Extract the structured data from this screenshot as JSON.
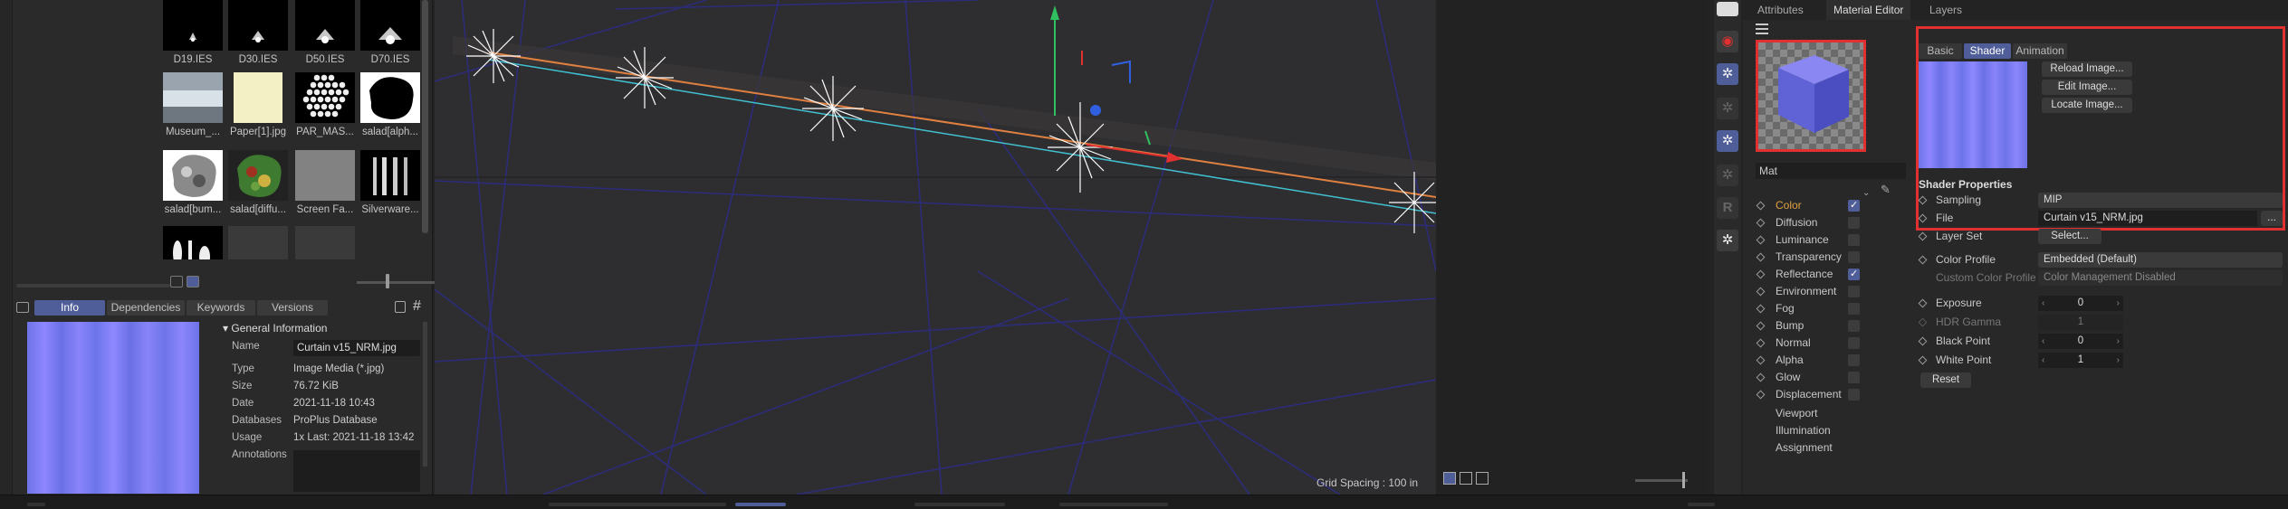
{
  "asset_browser": {
    "thumbnails": [
      {
        "label": "D19.IES",
        "kind": "ies"
      },
      {
        "label": "D30.IES",
        "kind": "ies"
      },
      {
        "label": "D50.IES",
        "kind": "ies"
      },
      {
        "label": "D70.IES",
        "kind": "ies"
      },
      {
        "label": "Museum_...",
        "kind": "museum"
      },
      {
        "label": "Paper[1].jpg",
        "kind": "paper"
      },
      {
        "label": "PAR_MAS...",
        "kind": "par"
      },
      {
        "label": "salad[alph...",
        "kind": "salad-alpha"
      },
      {
        "label": "salad[bum...",
        "kind": "salad-bump"
      },
      {
        "label": "salad[diffu...",
        "kind": "salad-diffuse"
      },
      {
        "label": "Screen Fa...",
        "kind": "screen"
      },
      {
        "label": "Silverware...",
        "kind": "silverware"
      },
      {
        "label": "",
        "kind": "cutlery"
      },
      {
        "label": "",
        "kind": "blank"
      },
      {
        "label": "",
        "kind": "blank"
      }
    ],
    "info_tabs": [
      "Info",
      "Dependencies",
      "Keywords",
      "Versions"
    ],
    "active_info_tab": "Info",
    "info": {
      "section_title": "▾ General Information",
      "rows": [
        {
          "key": "Name",
          "value": "Curtain v15_NRM.jpg"
        },
        {
          "key": "Type",
          "value": "Image Media (*.jpg)"
        },
        {
          "key": "Size",
          "value": "76.72 KiB"
        },
        {
          "key": "Date",
          "value": "2021-11-18 10:43"
        },
        {
          "key": "Databases",
          "value": "ProPlus Database"
        },
        {
          "key": "Usage",
          "value": "1x Last: 2021-11-18 13:42"
        },
        {
          "key": "Annotations",
          "value": ""
        }
      ]
    }
  },
  "viewport": {
    "grid_spacing": "Grid Spacing : 100 in"
  },
  "material_editor": {
    "tabs": [
      "Attributes",
      "Material Editor",
      "Layers"
    ],
    "active_tab": "Material Editor",
    "material_name": "Mat",
    "channels": [
      {
        "name": "Color",
        "checkbox": true,
        "checked": true,
        "active": true
      },
      {
        "name": "Diffusion",
        "checkbox": true,
        "checked": false
      },
      {
        "name": "Luminance",
        "checkbox": true,
        "checked": false
      },
      {
        "name": "Transparency",
        "checkbox": true,
        "checked": false
      },
      {
        "name": "Reflectance",
        "checkbox": true,
        "checked": true
      },
      {
        "name": "Environment",
        "checkbox": true,
        "checked": false
      },
      {
        "name": "Fog",
        "checkbox": true,
        "checked": false
      },
      {
        "name": "Bump",
        "checkbox": true,
        "checked": false
      },
      {
        "name": "Normal",
        "checkbox": true,
        "checked": false
      },
      {
        "name": "Alpha",
        "checkbox": true,
        "checked": false
      },
      {
        "name": "Glow",
        "checkbox": true,
        "checked": false
      },
      {
        "name": "Displacement",
        "checkbox": true,
        "checked": false
      },
      {
        "name": "Viewport",
        "checkbox": false
      },
      {
        "name": "Illumination",
        "checkbox": false
      },
      {
        "name": "Assignment",
        "checkbox": false
      }
    ],
    "shader_tabs": [
      "Basic",
      "Shader",
      "Animation"
    ],
    "active_shader_tab": "Shader",
    "image_buttons": [
      "Reload Image...",
      "Edit Image...",
      "Locate Image..."
    ],
    "shader_properties_title": "Shader Properties",
    "properties": {
      "sampling": {
        "label": "Sampling",
        "value": "MIP"
      },
      "file": {
        "label": "File",
        "value": "Curtain v15_NRM.jpg",
        "browse": "..."
      },
      "layer_set": {
        "label": "Layer Set",
        "button": "Select..."
      },
      "color_profile": {
        "label": "Color Profile",
        "value": "Embedded (Default)"
      },
      "custom_color_profile": {
        "label": "Custom Color Profile",
        "value": "Color Management Disabled"
      },
      "exposure": {
        "label": "Exposure",
        "value": "0"
      },
      "hdr_gamma": {
        "label": "HDR Gamma",
        "value": "1"
      },
      "black_point": {
        "label": "Black Point",
        "value": "0"
      },
      "white_point": {
        "label": "White Point",
        "value": "1"
      }
    },
    "reset_label": "Reset"
  },
  "colors": {
    "accent": "#4f5e98",
    "highlight_box": "#e03030",
    "active_channel": "#e0a040",
    "normal_map_blue": "#7b7ff0"
  }
}
